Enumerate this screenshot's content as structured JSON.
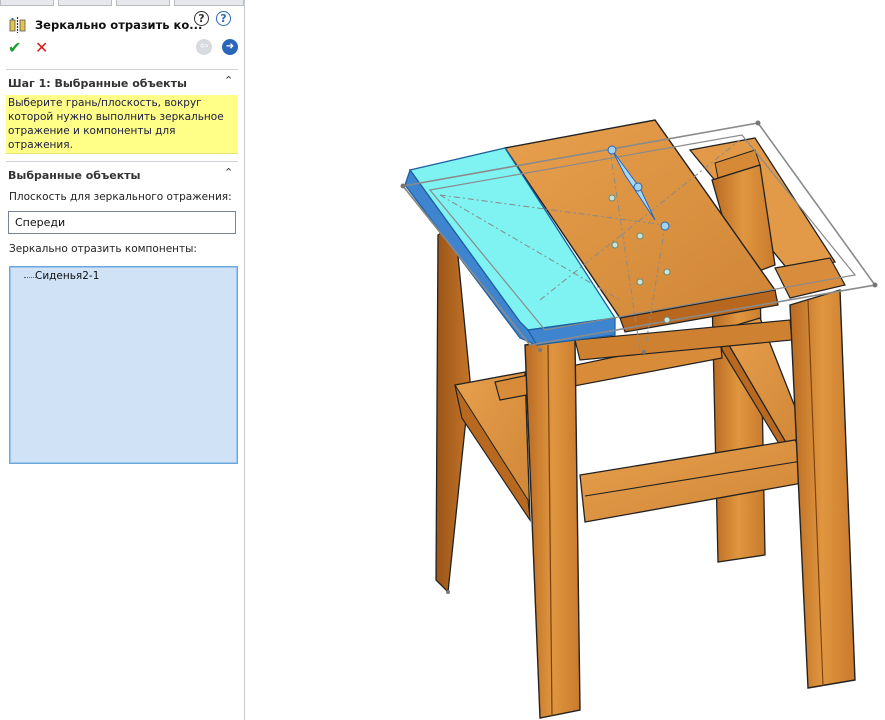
{
  "panel": {
    "title": "Зеркально отразить ко...",
    "help_glyph": "?",
    "ok_glyph": "✔",
    "cancel_glyph": "✕",
    "back_glyph": "⇦",
    "next_glyph": "➜",
    "step1": {
      "title": "Шаг 1: Выбранные объекты",
      "hint": "Выберите грань/плоскость, вокруг которой нужно выполнить зеркальное отражение и компоненты для отражения."
    },
    "selected": {
      "title": "Выбранные объекты",
      "plane_label": "Плоскость для зеркального отражения:",
      "plane_value": "Спереди",
      "components_label": "Зеркально отразить компоненты:",
      "components": [
        "Сиденья2-1"
      ]
    },
    "collapse_glyph": "⌃"
  },
  "icons": [
    "mirror-components-icon",
    "help-icon",
    "help-circle-icon",
    "ok-check-icon",
    "cancel-x-icon",
    "back-arrow-icon",
    "next-arrow-icon"
  ],
  "colors": {
    "wood": "#d98d3c",
    "selected_face": "#7ff2f2",
    "selected_edge": "#3f84cf",
    "hint_bg": "#ffff88",
    "list_bg": "#cfe2f6"
  }
}
